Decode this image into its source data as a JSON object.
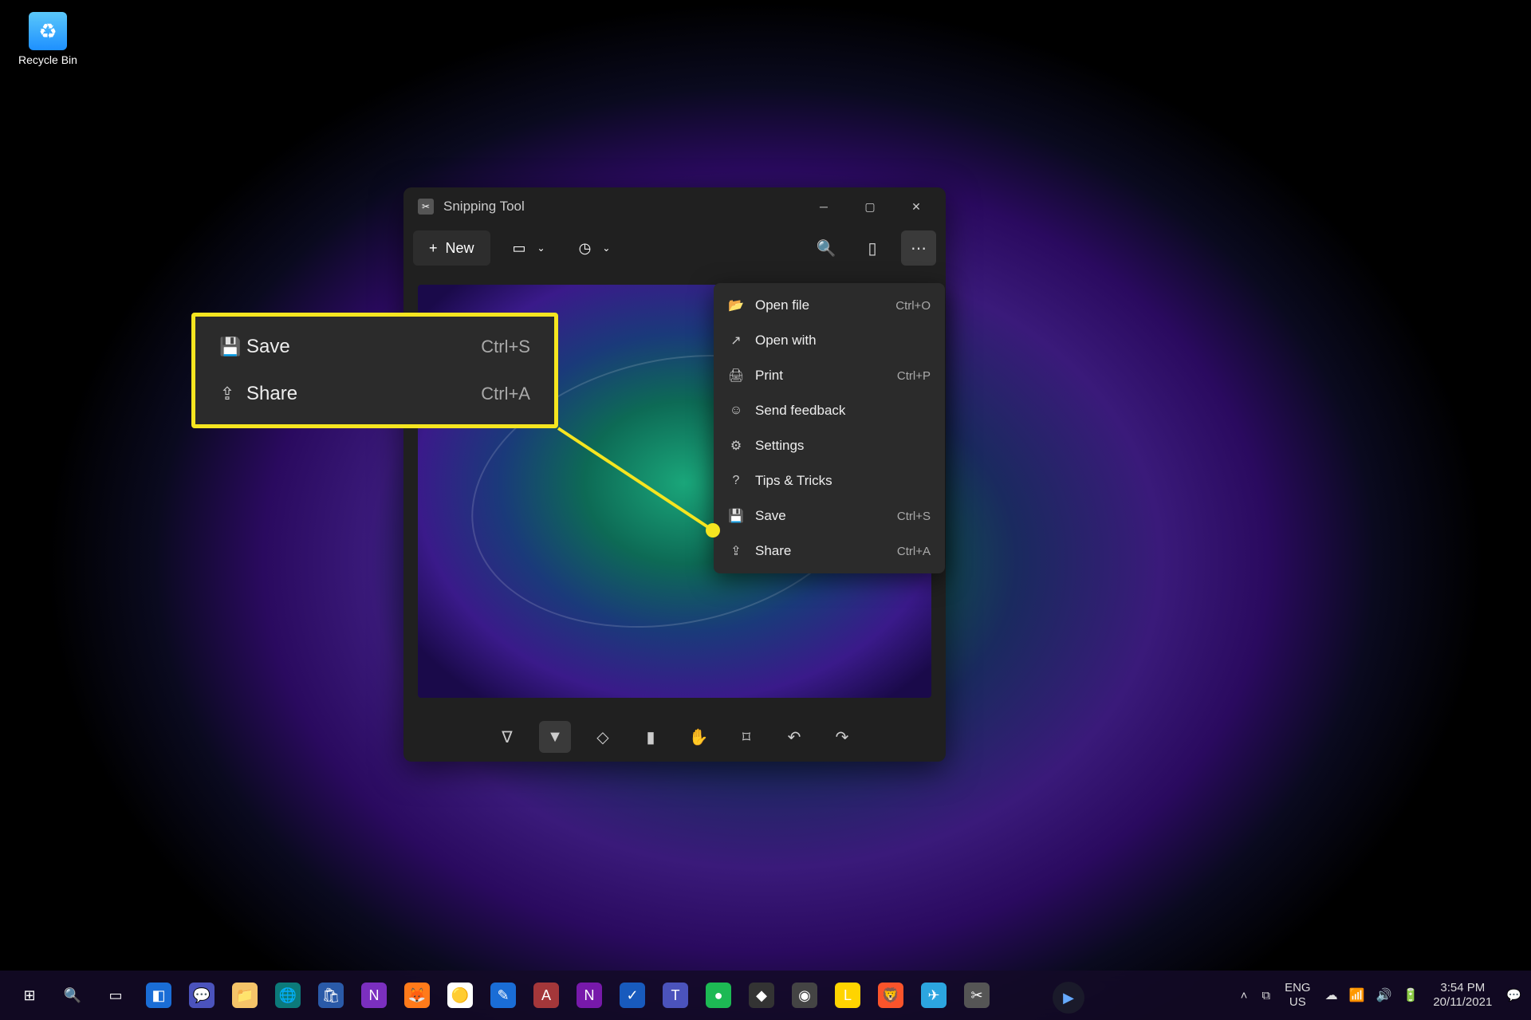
{
  "desktop": {
    "recycle_bin": "Recycle Bin"
  },
  "window": {
    "title": "Snipping Tool",
    "new_label": "New"
  },
  "context_menu": [
    {
      "icon": "📂",
      "label": "Open file",
      "shortcut": "Ctrl+O"
    },
    {
      "icon": "↗",
      "label": "Open with",
      "shortcut": ""
    },
    {
      "icon": "🖨",
      "label": "Print",
      "shortcut": "Ctrl+P"
    },
    {
      "icon": "☺",
      "label": "Send feedback",
      "shortcut": ""
    },
    {
      "icon": "⚙",
      "label": "Settings",
      "shortcut": ""
    },
    {
      "icon": "?",
      "label": "Tips & Tricks",
      "shortcut": ""
    },
    {
      "icon": "💾",
      "label": "Save",
      "shortcut": "Ctrl+S"
    },
    {
      "icon": "⇪",
      "label": "Share",
      "shortcut": "Ctrl+A"
    }
  ],
  "callout": [
    {
      "icon": "💾",
      "label": "Save",
      "shortcut": "Ctrl+S"
    },
    {
      "icon": "⇪",
      "label": "Share",
      "shortcut": "Ctrl+A"
    }
  ],
  "taskbar": {
    "apps": [
      {
        "name": "start",
        "glyph": "⊞",
        "bg": "transparent"
      },
      {
        "name": "search",
        "glyph": "🔍",
        "bg": "transparent"
      },
      {
        "name": "taskview",
        "glyph": "▭",
        "bg": "transparent"
      },
      {
        "name": "widgets",
        "glyph": "◧",
        "bg": "#1a6dd6"
      },
      {
        "name": "teams",
        "glyph": "💬",
        "bg": "#4b53bc"
      },
      {
        "name": "explorer",
        "glyph": "📁",
        "bg": "#f5c469"
      },
      {
        "name": "edge",
        "glyph": "🌐",
        "bg": "#0c7a7a"
      },
      {
        "name": "store",
        "glyph": "🛍",
        "bg": "#2a5aa8"
      },
      {
        "name": "onenote",
        "glyph": "N",
        "bg": "#7b2fbf"
      },
      {
        "name": "firefox",
        "glyph": "🦊",
        "bg": "#ff7a1a"
      },
      {
        "name": "chrome",
        "glyph": "🟡",
        "bg": "#fff"
      },
      {
        "name": "whiteboard",
        "glyph": "✎",
        "bg": "#1a6dd6"
      },
      {
        "name": "access",
        "glyph": "A",
        "bg": "#a4373a"
      },
      {
        "name": "onenote2",
        "glyph": "N",
        "bg": "#7719aa"
      },
      {
        "name": "todo",
        "glyph": "✓",
        "bg": "#185abd"
      },
      {
        "name": "teams2",
        "glyph": "T",
        "bg": "#4b53bc"
      },
      {
        "name": "spotify",
        "glyph": "●",
        "bg": "#1db954"
      },
      {
        "name": "app1",
        "glyph": "◆",
        "bg": "#333"
      },
      {
        "name": "app2",
        "glyph": "◉",
        "bg": "#444"
      },
      {
        "name": "lidl",
        "glyph": "L",
        "bg": "#ffd400"
      },
      {
        "name": "brave",
        "glyph": "🦁",
        "bg": "#fb542b"
      },
      {
        "name": "telegram",
        "glyph": "✈",
        "bg": "#2ca5e0"
      },
      {
        "name": "snip",
        "glyph": "✂",
        "bg": "#555"
      }
    ],
    "tray": {
      "lang1": "ENG",
      "lang2": "US",
      "time": "3:54 PM",
      "date": "20/11/2021"
    }
  }
}
